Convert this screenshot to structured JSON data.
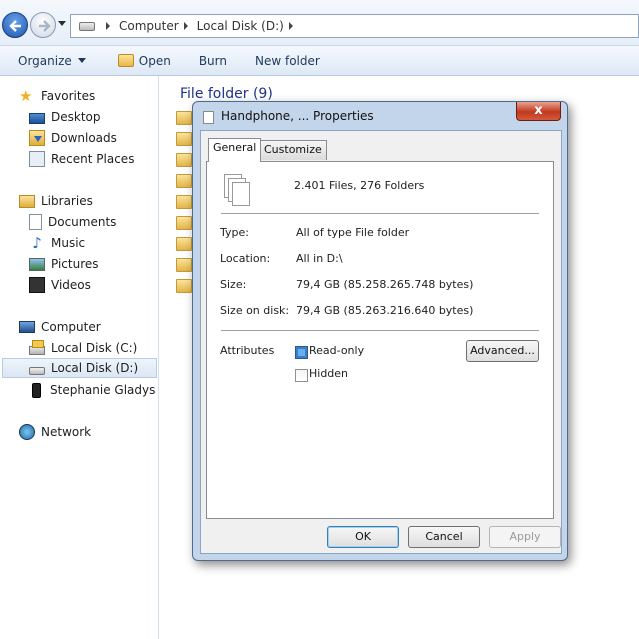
{
  "address": {
    "crumbs": [
      "Computer",
      "Local Disk (D:)"
    ]
  },
  "toolbar": {
    "organize": "Organize",
    "open": "Open",
    "burn": "Burn",
    "new_folder": "New folder"
  },
  "nav": {
    "favorites": "Favorites",
    "desktop": "Desktop",
    "downloads": "Downloads",
    "recent_places": "Recent Places",
    "libraries": "Libraries",
    "documents": "Documents",
    "music": "Music",
    "pictures": "Pictures",
    "videos": "Videos",
    "computer": "Computer",
    "local_disk_c": "Local Disk (C:)",
    "local_disk_d": "Local Disk (D:)",
    "stephanie": "Stephanie Gladys",
    "network": "Network"
  },
  "content": {
    "group_heading": "File folder (9)"
  },
  "dialog": {
    "title": "Handphone, ... Properties",
    "close": "x",
    "tabs": [
      "General",
      "Customize"
    ],
    "summary": "2.401 Files, 276 Folders",
    "type_label": "Type:",
    "type_value": "All of type File folder",
    "location_label": "Location:",
    "location_value": "All in D:\\",
    "size_label": "Size:",
    "size_value": "79,4 GB (85.258.265.748 bytes)",
    "size_on_disk_label": "Size on disk:",
    "size_on_disk_value": "79,4 GB (85.263.216.640 bytes)",
    "attributes_label": "Attributes",
    "readonly_label": "Read-only",
    "hidden_label": "Hidden",
    "advanced": "Advanced...",
    "ok": "OK",
    "cancel": "Cancel",
    "apply": "Apply"
  }
}
